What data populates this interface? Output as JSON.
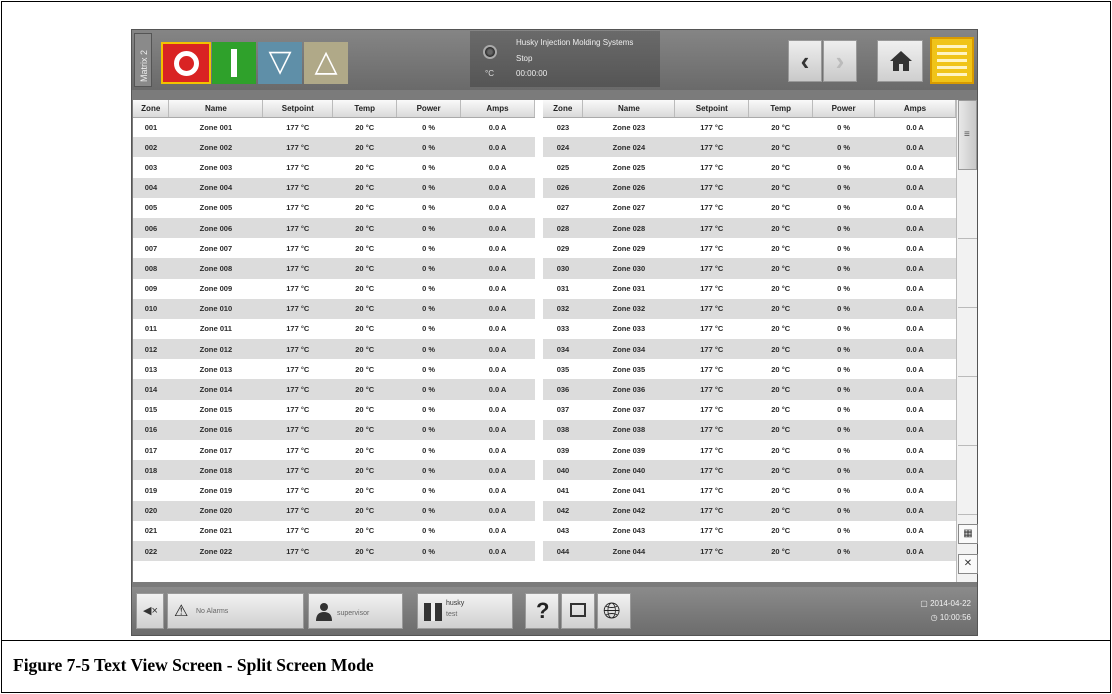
{
  "topbar": {
    "matrix_label": "Matrix 2",
    "status_unit": "°C",
    "status_title": "Husky Injection Molding Systems",
    "status_state": "Stop",
    "status_time": "00:00:00"
  },
  "table": {
    "columns": [
      "Zone",
      "Name",
      "Setpoint",
      "Temp",
      "Power",
      "Amps"
    ],
    "left_rows": [
      [
        "001",
        "Zone 001",
        "177 °C",
        "20 °C",
        "0 %",
        "0.0 A"
      ],
      [
        "002",
        "Zone 002",
        "177 °C",
        "20 °C",
        "0 %",
        "0.0 A"
      ],
      [
        "003",
        "Zone 003",
        "177 °C",
        "20 °C",
        "0 %",
        "0.0 A"
      ],
      [
        "004",
        "Zone 004",
        "177 °C",
        "20 °C",
        "0 %",
        "0.0 A"
      ],
      [
        "005",
        "Zone 005",
        "177 °C",
        "20 °C",
        "0 %",
        "0.0 A"
      ],
      [
        "006",
        "Zone 006",
        "177 °C",
        "20 °C",
        "0 %",
        "0.0 A"
      ],
      [
        "007",
        "Zone 007",
        "177 °C",
        "20 °C",
        "0 %",
        "0.0 A"
      ],
      [
        "008",
        "Zone 008",
        "177 °C",
        "20 °C",
        "0 %",
        "0.0 A"
      ],
      [
        "009",
        "Zone 009",
        "177 °C",
        "20 °C",
        "0 %",
        "0.0 A"
      ],
      [
        "010",
        "Zone 010",
        "177 °C",
        "20 °C",
        "0 %",
        "0.0 A"
      ],
      [
        "011",
        "Zone 011",
        "177 °C",
        "20 °C",
        "0 %",
        "0.0 A"
      ],
      [
        "012",
        "Zone 012",
        "177 °C",
        "20 °C",
        "0 %",
        "0.0 A"
      ],
      [
        "013",
        "Zone 013",
        "177 °C",
        "20 °C",
        "0 %",
        "0.0 A"
      ],
      [
        "014",
        "Zone 014",
        "177 °C",
        "20 °C",
        "0 %",
        "0.0 A"
      ],
      [
        "015",
        "Zone 015",
        "177 °C",
        "20 °C",
        "0 %",
        "0.0 A"
      ],
      [
        "016",
        "Zone 016",
        "177 °C",
        "20 °C",
        "0 %",
        "0.0 A"
      ],
      [
        "017",
        "Zone 017",
        "177 °C",
        "20 °C",
        "0 %",
        "0.0 A"
      ],
      [
        "018",
        "Zone 018",
        "177 °C",
        "20 °C",
        "0 %",
        "0.0 A"
      ],
      [
        "019",
        "Zone 019",
        "177 °C",
        "20 °C",
        "0 %",
        "0.0 A"
      ],
      [
        "020",
        "Zone 020",
        "177 °C",
        "20 °C",
        "0 %",
        "0.0 A"
      ],
      [
        "021",
        "Zone 021",
        "177 °C",
        "20 °C",
        "0 %",
        "0.0 A"
      ],
      [
        "022",
        "Zone 022",
        "177 °C",
        "20 °C",
        "0 %",
        "0.0 A"
      ]
    ],
    "right_rows": [
      [
        "023",
        "Zone 023",
        "177 °C",
        "20 °C",
        "0 %",
        "0.0 A"
      ],
      [
        "024",
        "Zone 024",
        "177 °C",
        "20 °C",
        "0 %",
        "0.0 A"
      ],
      [
        "025",
        "Zone 025",
        "177 °C",
        "20 °C",
        "0 %",
        "0.0 A"
      ],
      [
        "026",
        "Zone 026",
        "177 °C",
        "20 °C",
        "0 %",
        "0.0 A"
      ],
      [
        "027",
        "Zone 027",
        "177 °C",
        "20 °C",
        "0 %",
        "0.0 A"
      ],
      [
        "028",
        "Zone 028",
        "177 °C",
        "20 °C",
        "0 %",
        "0.0 A"
      ],
      [
        "029",
        "Zone 029",
        "177 °C",
        "20 °C",
        "0 %",
        "0.0 A"
      ],
      [
        "030",
        "Zone 030",
        "177 °C",
        "20 °C",
        "0 %",
        "0.0 A"
      ],
      [
        "031",
        "Zone 031",
        "177 °C",
        "20 °C",
        "0 %",
        "0.0 A"
      ],
      [
        "032",
        "Zone 032",
        "177 °C",
        "20 °C",
        "0 %",
        "0.0 A"
      ],
      [
        "033",
        "Zone 033",
        "177 °C",
        "20 °C",
        "0 %",
        "0.0 A"
      ],
      [
        "034",
        "Zone 034",
        "177 °C",
        "20 °C",
        "0 %",
        "0.0 A"
      ],
      [
        "035",
        "Zone 035",
        "177 °C",
        "20 °C",
        "0 %",
        "0.0 A"
      ],
      [
        "036",
        "Zone 036",
        "177 °C",
        "20 °C",
        "0 %",
        "0.0 A"
      ],
      [
        "037",
        "Zone 037",
        "177 °C",
        "20 °C",
        "0 %",
        "0.0 A"
      ],
      [
        "038",
        "Zone 038",
        "177 °C",
        "20 °C",
        "0 %",
        "0.0 A"
      ],
      [
        "039",
        "Zone 039",
        "177 °C",
        "20 °C",
        "0 %",
        "0.0 A"
      ],
      [
        "040",
        "Zone 040",
        "177 °C",
        "20 °C",
        "0 %",
        "0.0 A"
      ],
      [
        "041",
        "Zone 041",
        "177 °C",
        "20 °C",
        "0 %",
        "0.0 A"
      ],
      [
        "042",
        "Zone 042",
        "177 °C",
        "20 °C",
        "0 %",
        "0.0 A"
      ],
      [
        "043",
        "Zone 043",
        "177 °C",
        "20 °C",
        "0 %",
        "0.0 A"
      ],
      [
        "044",
        "Zone 044",
        "177 °C",
        "20 °C",
        "0 %",
        "0.0 A"
      ]
    ]
  },
  "bottombar": {
    "alarms_label": "No Alarms",
    "user_label": "supervisor",
    "mold_name": "husky",
    "mold_sub": "test",
    "date": "2014-04-22",
    "time": "10:00:56"
  },
  "caption": "Figure 7-5    Text View Screen - Split Screen Mode",
  "icons": [
    "stop-icon",
    "start-icon",
    "down-arrow-icon",
    "up-arrow-icon",
    "back-arrow-icon",
    "forward-arrow-icon",
    "home-icon",
    "grid-menu-icon",
    "mute-icon",
    "alarm-icon",
    "user-icon",
    "mold-icon",
    "help-icon",
    "screenshot-icon",
    "language-globe-icon",
    "keypad-icon",
    "close-keypad-icon"
  ],
  "colors": {
    "stop": "#d92323",
    "start": "#2fa12b",
    "highlight": "#f0c419"
  }
}
